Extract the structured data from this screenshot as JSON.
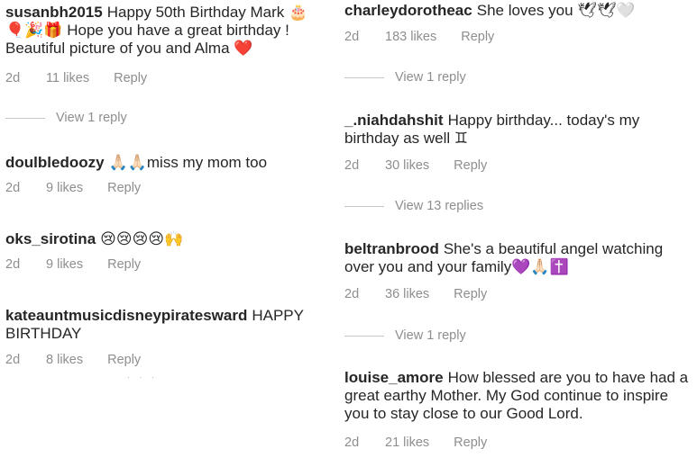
{
  "left_comments": [
    {
      "username": "susanbh2015",
      "text": "Happy 50th Birthday Mark 🎂 🎈🎉🎁 Hope you have a great birthday ! Beautiful picture of you and Alma ❤️",
      "time": "2d",
      "likes": "11 likes",
      "reply": "Reply"
    },
    {
      "username": "doulbledoozy",
      "text": "🙏🏻🙏🏻miss my mom too",
      "time": "2d",
      "likes": "9 likes",
      "reply": "Reply"
    },
    {
      "username": "oks_sirotina",
      "text": "😢😢😢😢🙌",
      "time": "2d",
      "likes": "9 likes",
      "reply": "Reply"
    },
    {
      "username": "kateauntmusicdisneypiratesward",
      "text": "HAPPY BIRTHDAY",
      "time": "2d",
      "likes": "8 likes",
      "reply": "Reply"
    }
  ],
  "left_view_replies": [
    "View 1 reply"
  ],
  "right_comments": [
    {
      "username": "charleydorotheac",
      "text": "She loves you 🕊🕊🤍",
      "time": "2d",
      "likes": "183 likes",
      "reply": "Reply"
    },
    {
      "username": "_.niahdahshit",
      "text": "Happy birthday... today's my birthday as well ♊",
      "time": "2d",
      "likes": "30 likes",
      "reply": "Reply"
    },
    {
      "username": "beltranbrood",
      "text": "She's a beautiful angel watching over you and your family💜🙏🏻✝️",
      "time": "2d",
      "likes": "36 likes",
      "reply": "Reply"
    },
    {
      "username": "louise_amore",
      "text": "How blessed are you to have had a great earthy Mother. My God continue to inspire you to stay close to our Good Lord.",
      "time": "2d",
      "likes": "21 likes",
      "reply": "Reply"
    }
  ],
  "right_view_replies": [
    "View 1 reply",
    "View 13 replies",
    "View 1 reply"
  ],
  "colors": {
    "text": "#262626",
    "meta": "#8e8e8e",
    "divider": "#c7c7c7"
  }
}
